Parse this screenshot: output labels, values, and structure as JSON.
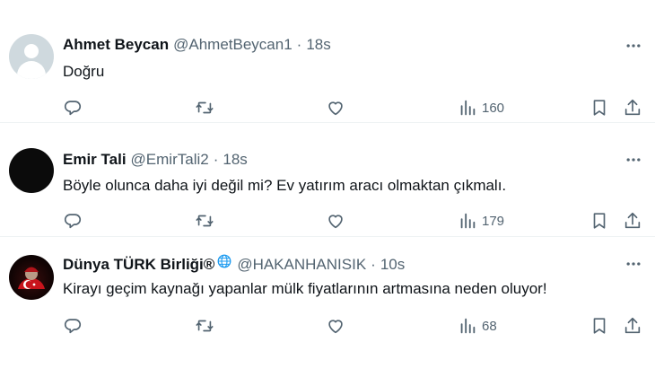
{
  "tweets": [
    {
      "name": "Ahmet Beycan",
      "handle": "@AhmetBeycan1",
      "separator": "·",
      "time": "18s",
      "text": "Doğru",
      "avatar": "default-avatar",
      "views": "160"
    },
    {
      "name": "Emir Tali",
      "handle": "@EmirTali2",
      "separator": "·",
      "time": "18s",
      "text": "Böyle olunca daha iyi değil mi? Ev yatırım aracı olmaktan çıkmalı.",
      "avatar": "black-avatar",
      "views": "179"
    },
    {
      "name": "Dünya TÜRK Birliği®",
      "handle": "@HAKANHANISIK",
      "separator": "·",
      "time": "10s",
      "text": "Kirayı geçim kaynağı yapanlar mülk fiyatlarının artmasına neden oluyor!",
      "avatar": "turkish-flag-avatar",
      "views": "68"
    }
  ],
  "icons": {
    "reply": "reply-icon",
    "retweet": "retweet-icon",
    "like": "heart-icon",
    "views": "views-bar-chart-icon",
    "bookmark": "bookmark-icon",
    "share": "share-icon",
    "more": "more-dots-icon",
    "globe": "globe-icon"
  },
  "colors": {
    "text": "#0f1419",
    "secondary": "#536471",
    "divider": "#eff3f4",
    "globe": "#1d9bf0"
  }
}
